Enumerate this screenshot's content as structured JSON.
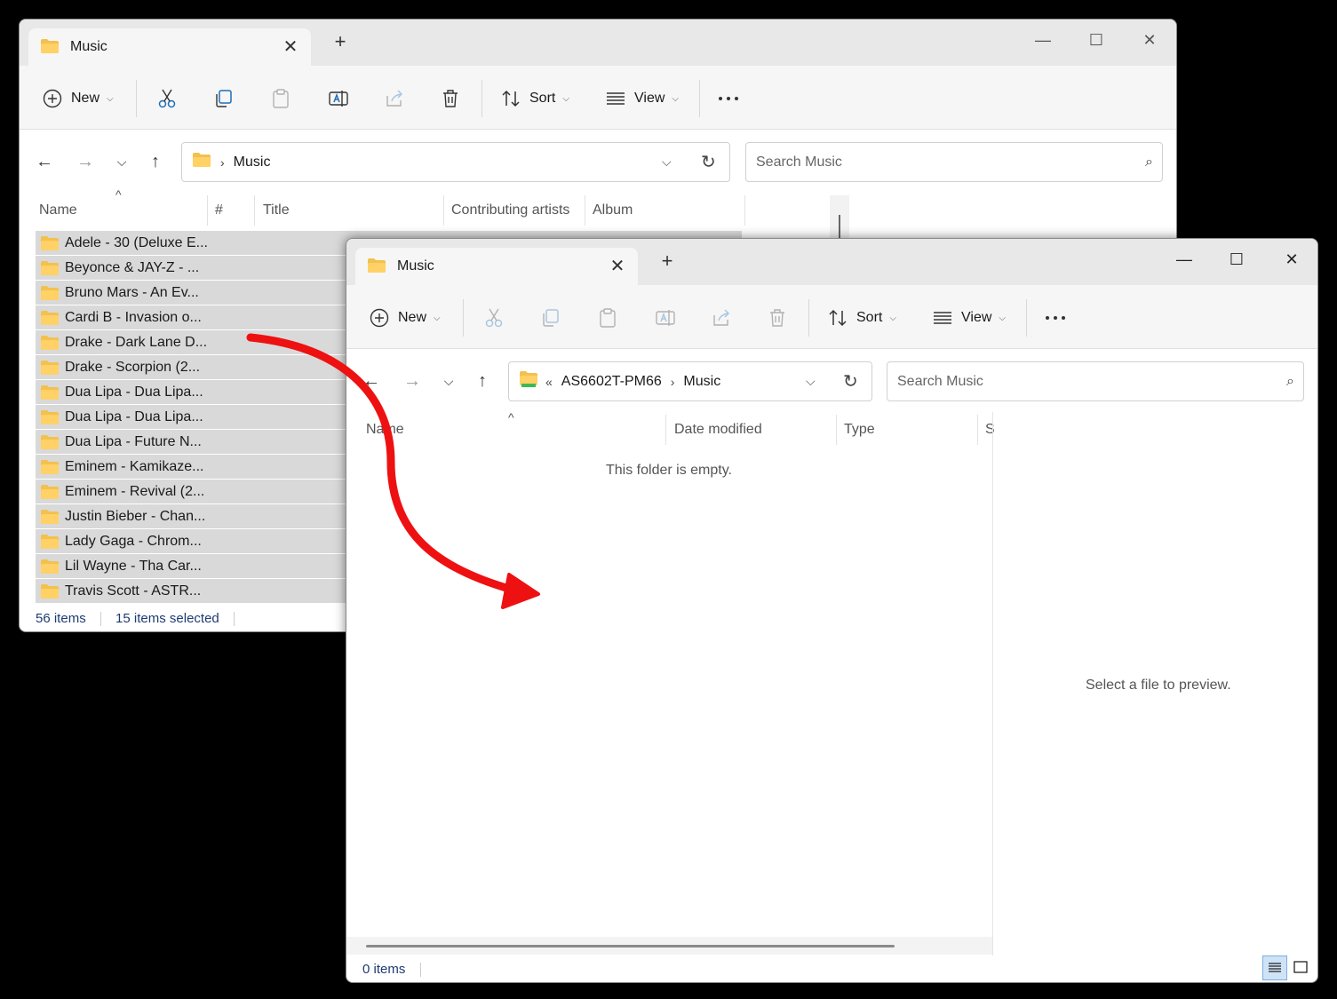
{
  "back_window": {
    "tab_title": "Music",
    "toolbar": {
      "new_label": "New",
      "sort_label": "Sort",
      "view_label": "View"
    },
    "breadcrumb": [
      "Music"
    ],
    "search_placeholder": "Search Music",
    "columns": [
      "Name",
      "#",
      "Title",
      "Contributing artists",
      "Album"
    ],
    "items": [
      "Adele - 30 (Deluxe E...",
      "Beyonce & JAY-Z - ...",
      "Bruno Mars - An Ev...",
      "Cardi B - Invasion o...",
      "Drake - Dark Lane D...",
      "Drake - Scorpion (2...",
      "Dua Lipa - Dua Lipa...",
      "Dua Lipa - Dua Lipa...",
      "Dua Lipa - Future N...",
      "Eminem - Kamikaze...",
      "Eminem - Revival (2...",
      "Justin Bieber - Chan...",
      "Lady Gaga - Chrom...",
      "Lil Wayne - Tha Car...",
      "Travis Scott - ASTR..."
    ],
    "status_count": "56 items",
    "status_selected": "15 items selected"
  },
  "front_window": {
    "tab_title": "Music",
    "toolbar": {
      "new_label": "New",
      "sort_label": "Sort",
      "view_label": "View"
    },
    "breadcrumb_overflow": "«",
    "breadcrumb": [
      "AS6602T-PM66",
      "Music"
    ],
    "search_placeholder": "Search Music",
    "columns": [
      "Name",
      "Date modified",
      "Type",
      "S"
    ],
    "empty_message": "This folder is empty.",
    "preview_message": "Select a file to preview.",
    "status_count": "0 items"
  },
  "colors": {
    "folder": "#f2c14e",
    "selection": "#d9d9d9",
    "status_text": "#1f3b73",
    "arrow": "#ee1111"
  }
}
